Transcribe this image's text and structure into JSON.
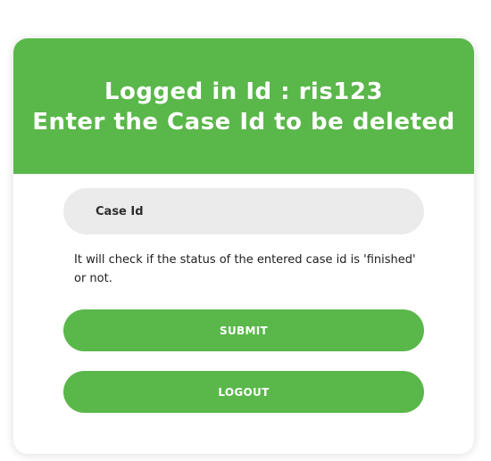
{
  "header": {
    "line1": "Logged in Id : ris123",
    "line2": "Enter the Case Id to be deleted"
  },
  "form": {
    "case_id_placeholder": "Case Id",
    "case_id_value": "",
    "info_text": "It will check if the status of the entered case id is 'finished' or not.",
    "submit_label": "SUBMIT",
    "logout_label": "LOGOUT"
  },
  "colors": {
    "accent": "#5ab74a",
    "input_bg": "#ebebeb",
    "page_bg": "#ffffff"
  }
}
